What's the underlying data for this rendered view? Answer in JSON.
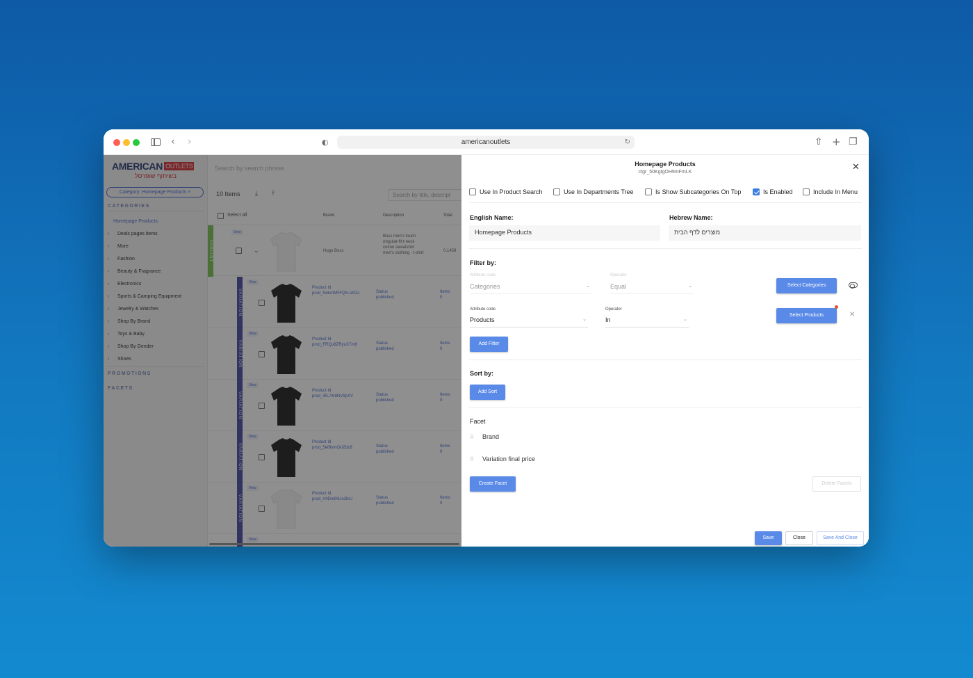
{
  "browser": {
    "url": "americanoutlets"
  },
  "sidebar": {
    "logo_main": "AMERICAN",
    "logo_badge": "OUTLETS",
    "logo_sub": "בשיתוף שופרסל",
    "category_pill": "Category: Homepage Products",
    "categories_header": "CATEGORIES",
    "active_item": "Homepage Products",
    "items": [
      "Deals pages items",
      "More",
      "Fashion",
      "Beauty & Fragrance",
      "Electronics",
      "Sports & Camping Equipment",
      "Jewelry & Watches",
      "Shop By Brand",
      "Toys & Baby",
      "Shop By Gender",
      "Shoes"
    ],
    "promotions_header": "PROMOTIONS",
    "facets_header": "FACETS"
  },
  "list": {
    "search_placeholder": "Search by search phrase",
    "items_count": "10 Items",
    "search_title_placeholder": "Search by title, descript",
    "select_all": "Select all",
    "columns": [
      "Brand",
      "Description",
      "Total"
    ],
    "main_row": {
      "variant_label": "VARIANT",
      "view_tag": "View",
      "brand": "Hugo Boss",
      "description": "Boss men's touch (regular-fit t-neck cotton sweatshirt men's clothing - t-shirt",
      "total": "0.1459"
    },
    "variations": [
      {
        "label": "VARIATION",
        "view": "View",
        "product_id_label": "Product Id",
        "product_id": "prod_NnkoWRFQN-sKDc",
        "status_label": "Status",
        "status": "published",
        "items_label": "Items",
        "items": "0",
        "color": "black"
      },
      {
        "label": "VARIATION",
        "view": "View",
        "product_id_label": "Product Id",
        "product_id": "prod_FRQu8ZRyuX7m8",
        "status_label": "Status",
        "status": "published",
        "items_label": "Items",
        "items": "0",
        "color": "black"
      },
      {
        "label": "VARIATION",
        "view": "View",
        "product_id_label": "Product Id",
        "product_id": "prod_iRL74I8NV9pXV",
        "status_label": "Status",
        "status": "published",
        "items_label": "Items",
        "items": "0",
        "color": "black"
      },
      {
        "label": "VARIATION",
        "view": "View",
        "product_id_label": "Product Id",
        "product_id": "prod_5eiBsmOUZdz8",
        "status_label": "Status",
        "status": "published",
        "items_label": "Items",
        "items": "0",
        "color": "black"
      },
      {
        "label": "VARIATION",
        "view": "View",
        "product_id_label": "Product Id",
        "product_id": "prod_rrhDn8NUo2fxU",
        "status_label": "Status",
        "status": "published",
        "items_label": "Items",
        "items": "0",
        "color": "white"
      }
    ],
    "last_tag": "View"
  },
  "panel": {
    "title": "Homepage Products",
    "subtitle": "ctgr_50KgIgOH9mFmLK",
    "options": [
      {
        "label": "Use In Product Search",
        "checked": false
      },
      {
        "label": "Use In Departments Tree",
        "checked": false
      },
      {
        "label": "Is Show Subcategories On Top",
        "checked": false
      },
      {
        "label": "Is Enabled",
        "checked": true
      },
      {
        "label": "Include In Menu",
        "checked": false
      }
    ],
    "english_name_label": "English Name:",
    "english_name_value": "Homepage Products",
    "hebrew_name_label": "Hebrew Name:",
    "hebrew_name_value": "מוצרים לדף הבית",
    "filter_by_label": "Filter by:",
    "filters": [
      {
        "attr_label": "Attribute code",
        "attr_value": "Categories",
        "op_label": "Operator",
        "op_value": "Equal",
        "button": "Select Categories",
        "faded": true
      },
      {
        "attr_label": "Attribute code",
        "attr_value": "Products",
        "op_label": "Operator",
        "op_value": "In",
        "button": "Select Products",
        "faded": false
      }
    ],
    "add_filter": "Add Filter",
    "sort_by_label": "Sort by:",
    "add_sort": "Add Sort",
    "facet_label": "Facet",
    "facets": [
      "Brand",
      "Variation final price"
    ],
    "create_facet": "Create Facet",
    "delete_facets": "Delete Facets",
    "footer": {
      "save": "Save",
      "close": "Close",
      "save_and_close": "Save And Close"
    }
  },
  "colors": {
    "accent_blue": "#5a8ae8",
    "variant_green": "#6fbf4a",
    "variation_navy": "#3b3fa0",
    "brand_red": "#d3222a"
  }
}
